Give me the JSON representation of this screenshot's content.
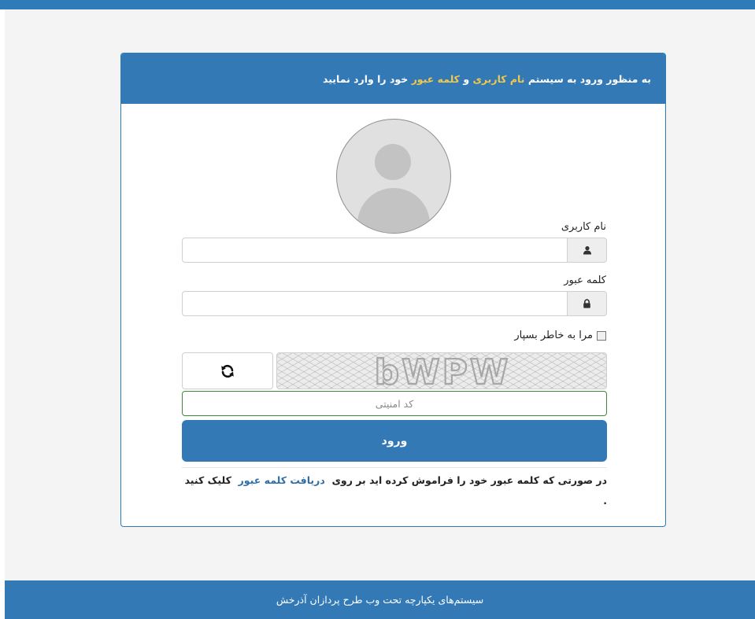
{
  "header": {
    "part1": "به منظور ورود به سیستم",
    "username_hl": "نام کاربری",
    "and": "و",
    "password_hl": "کلمه عبور",
    "part2": "خود را وارد نمایید"
  },
  "form": {
    "username_label": "نام کاربری",
    "username_value": "",
    "password_label": "کلمه عبور",
    "password_value": "",
    "remember_label": "مرا به خاطر بسپار",
    "remember_checked": false,
    "captcha_text": "bWPW",
    "code_placeholder": "کد امنیتی",
    "login_label": "ورود"
  },
  "forgot": {
    "before": "در صورتی که کلمه عبور خود را فراموش کرده اید بر روی",
    "link": "دریافت کلمه عبور",
    "after": "کلیک کنید ."
  },
  "footer": {
    "text": "سیستم‌های یکپارچه تحت وب طرح پردازان آذرخش"
  },
  "icons": {
    "username": "user-icon",
    "password": "lock-icon",
    "refresh": "refresh-icon",
    "avatar": "avatar-placeholder"
  },
  "colors": {
    "primary": "#3279b6",
    "highlight": "#f3c84a",
    "code_border": "#3b8a3b"
  }
}
